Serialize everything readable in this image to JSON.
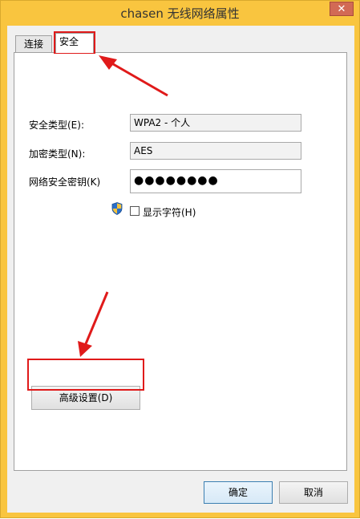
{
  "window": {
    "title": "chasen 无线网络属性",
    "close_glyph": "✕"
  },
  "tabs": [
    {
      "label": "连接",
      "active": false
    },
    {
      "label": "安全",
      "active": true
    }
  ],
  "security": {
    "type_label": "安全类型(E):",
    "type_value": "WPA2 - 个人",
    "encryption_label": "加密类型(N):",
    "encryption_value": "AES",
    "key_label": "网络安全密钥(K)",
    "key_value": "●●●●●●●●",
    "show_chars_label": "显示字符(H)",
    "show_chars_checked": false
  },
  "advanced_button": "高级设置(D)",
  "footer": {
    "ok": "确定",
    "cancel": "取消"
  },
  "colors": {
    "frame": "#f9c53f",
    "annotation": "#e01a1a"
  },
  "icons": {
    "shield": "shield-icon",
    "dropdown": "chevron-down-icon"
  }
}
